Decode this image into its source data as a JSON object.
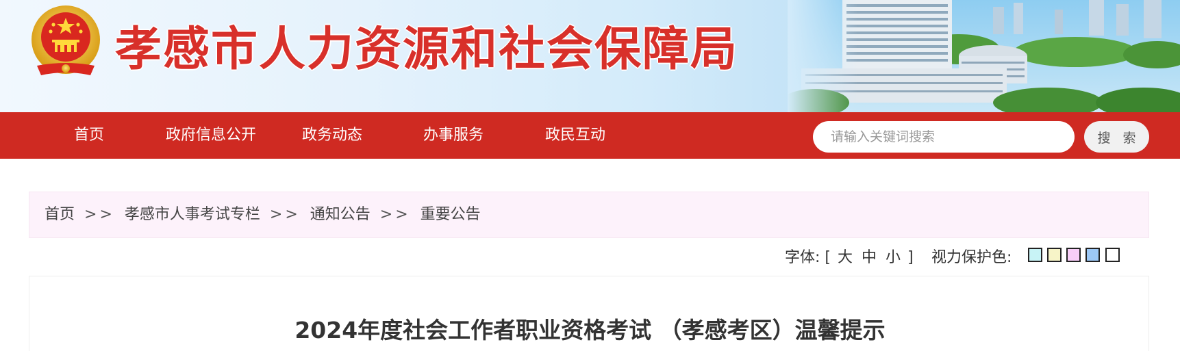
{
  "header": {
    "site_title": "孝感市人力资源和社会保障局",
    "title_color": "#d8302a"
  },
  "nav": {
    "bar_color": "#cf2a22",
    "items": [
      {
        "label": "首页"
      },
      {
        "label": "政府信息公开"
      },
      {
        "label": "政务动态"
      },
      {
        "label": "办事服务"
      },
      {
        "label": "政民互动"
      }
    ],
    "search": {
      "placeholder": "请输入关键词搜索",
      "button_label": "搜 索"
    }
  },
  "breadcrumb": {
    "items": [
      "首页",
      "孝感市人事考试专栏",
      "通知公告",
      "重要公告"
    ],
    "separator": ">>"
  },
  "tools": {
    "font_label": "字体:",
    "open_bracket": "[",
    "close_bracket": "]",
    "font_sizes": [
      "大",
      "中",
      "小"
    ],
    "eye_care_label": "视力保护色:",
    "swatches": [
      "#c8f3f6",
      "#f7f4c8",
      "#f8cef8",
      "#9cc8f6",
      "#ffffff"
    ]
  },
  "article": {
    "title": "2024年度社会工作者职业资格考试 （孝感考区）温馨提示"
  }
}
